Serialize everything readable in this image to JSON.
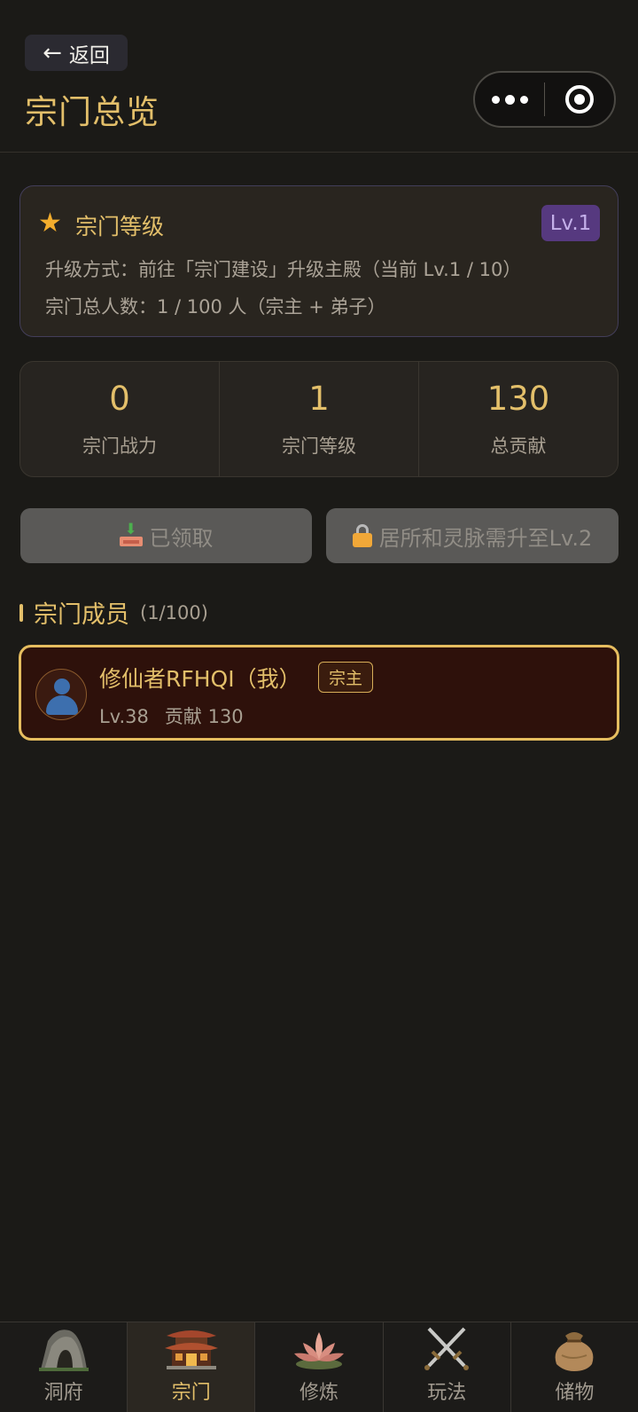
{
  "header": {
    "back_label": "返回",
    "title": "宗门总览"
  },
  "level_card": {
    "title": "宗门等级",
    "badge": "Lv.1",
    "upgrade_line": "升级方式：前往「宗门建设」升级主殿（当前 Lv.1 / 10）",
    "members_line": "宗门总人数：1 / 100 人（宗主 + 弟子）"
  },
  "stats": [
    {
      "value": "0",
      "label": "宗门战力"
    },
    {
      "value": "1",
      "label": "宗门等级"
    },
    {
      "value": "130",
      "label": "总贡献"
    }
  ],
  "actions": {
    "claimed_label": "已领取",
    "locked_label": "居所和灵脉需升至Lv.2"
  },
  "members_section": {
    "title": "宗门成员",
    "count": "(1/100)",
    "members": [
      {
        "name": "修仙者RFHQI（我）",
        "role": "宗主",
        "level": "Lv.38",
        "contribution": "贡献 130"
      }
    ]
  },
  "tabbar": {
    "items": [
      {
        "label": "洞府",
        "icon": "cave-icon"
      },
      {
        "label": "宗门",
        "icon": "temple-icon",
        "active": true
      },
      {
        "label": "修炼",
        "icon": "lotus-icon"
      },
      {
        "label": "玩法",
        "icon": "crossed-swords-icon"
      },
      {
        "label": "储物",
        "icon": "pouch-icon"
      }
    ]
  },
  "colors": {
    "accent_gold": "#e3bf6a",
    "background": "#1b1a17",
    "level_badge": "#56397f",
    "member_card": "#2e110b"
  }
}
